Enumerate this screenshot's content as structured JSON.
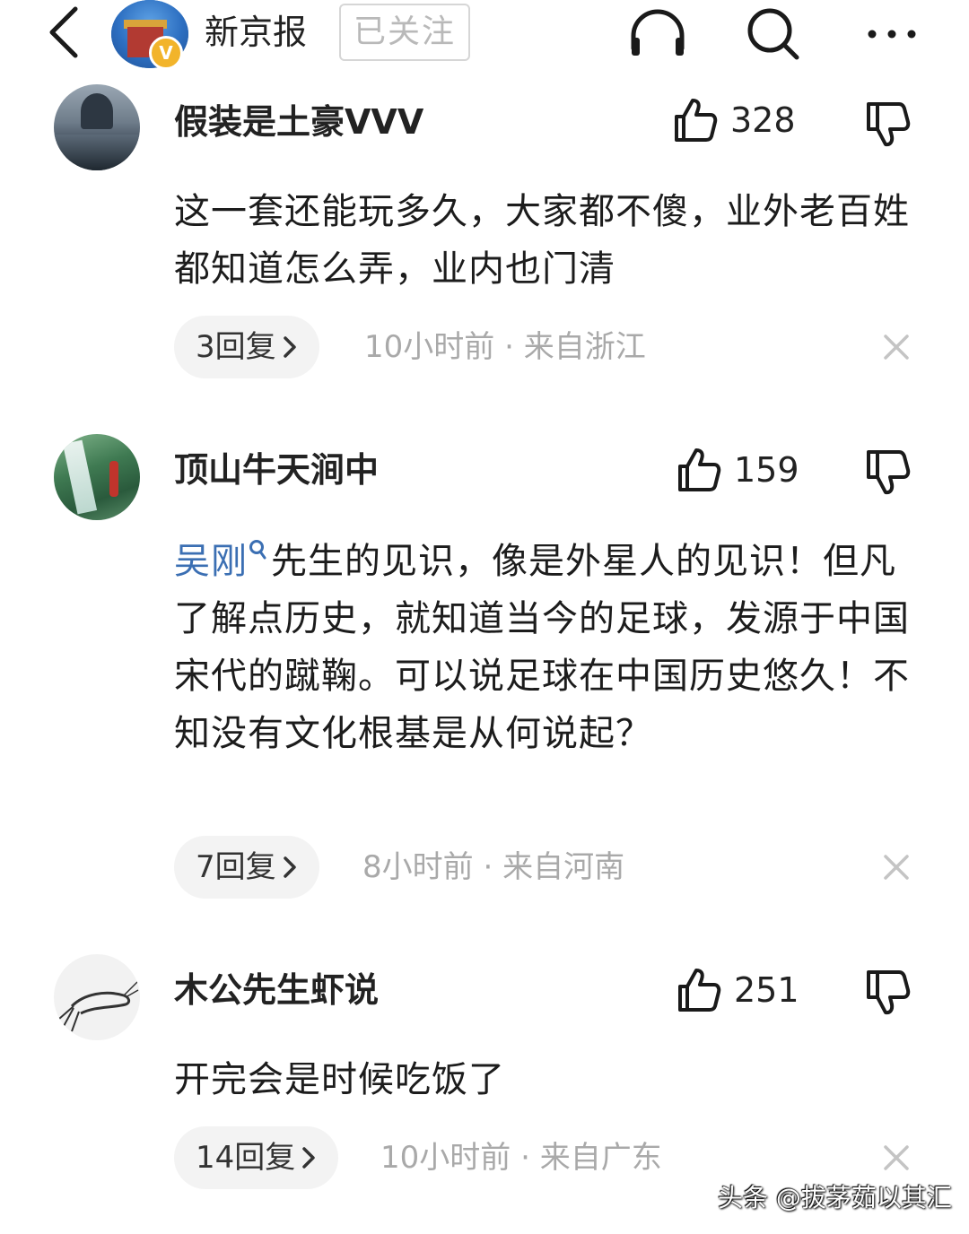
{
  "header": {
    "channel_name": "新京报",
    "follow_label": "已关注",
    "verified_mark": "V",
    "icons": [
      "back-arrow-icon",
      "headphones-icon",
      "search-icon",
      "more-dots-icon"
    ]
  },
  "comments": [
    {
      "username": "假装是土豪VVV",
      "likes": "328",
      "text": "这一套还能玩多久，大家都不傻，业外老百姓都知道怎么弄，业内也门清",
      "replies": "3回复",
      "time": "10小时前",
      "location": "来自浙江",
      "separator": "·"
    },
    {
      "username": "顶山牛天涧中",
      "likes": "159",
      "mention": "吴刚",
      "text": "先生的见识，像是外星人的见识！但凡了解点历史，就知道当今的足球，发源于中国宋代的蹴鞠。可以说足球在中国历史悠久！不知没有文化根基是从何说起？",
      "replies": "7回复",
      "time": "8小时前",
      "location": "来自河南",
      "separator": "·"
    },
    {
      "username": "木公先生虾说",
      "likes": "251",
      "text": "开完会是时候吃饭了",
      "replies": "14回复",
      "time": "10小时前",
      "location": "来自广东",
      "separator": "·"
    }
  ],
  "watermark": "头条 @拔茅茹以其汇",
  "colors": {
    "mention": "#3b6fb3",
    "meta": "#a9a9a9",
    "pill_bg": "#f3f3f3",
    "verified": "#f2b42b"
  }
}
